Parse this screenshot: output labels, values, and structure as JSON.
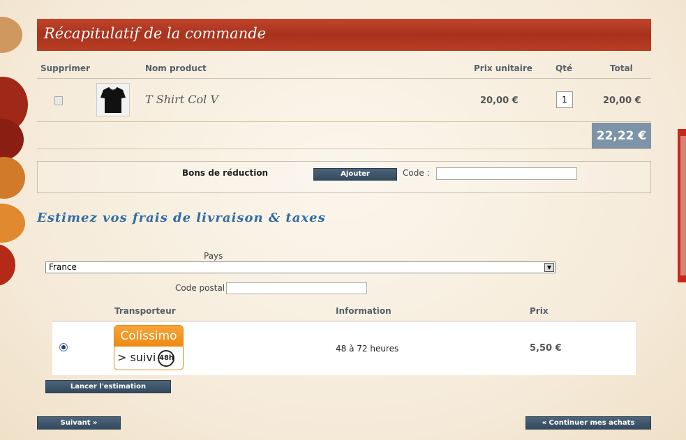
{
  "cart": {
    "title": "Récapitulatif de la commande",
    "headers": {
      "delete": "Supprimer",
      "product": "Nom product",
      "unit_price": "Prix unitaire",
      "qty": "Qté",
      "total": "Total"
    },
    "item": {
      "name": "T Shirt Col V",
      "unit_price": "20,00 €",
      "qty": "1",
      "total": "20,00 €"
    },
    "grand_total": "22,22 €"
  },
  "voucher": {
    "label": "Bons de réduction",
    "add_button": "Ajouter",
    "code_label": "Code :",
    "code_value": ""
  },
  "shipping": {
    "title": "Estimez vos frais de livraison & taxes",
    "country_label": "Pays",
    "country_value": "France",
    "postcode_label": "Code postal",
    "postcode_value": "",
    "headers": {
      "carrier": "Transporteur",
      "info": "Information",
      "price": "Prix"
    },
    "carrier": {
      "logo_top": "Colissimo",
      "logo_bottom": "> suivi",
      "logo_badge": "48h",
      "info": "48 à 72 heures",
      "price": "5,50 €",
      "selected": true
    },
    "estimate_button": "Lancer l'estimation"
  },
  "nav": {
    "next_button": "Suivant »",
    "continue_button": "« Continuer mes achats"
  },
  "colors": {
    "title_bar": "#b23a22",
    "button": "#3a5166",
    "grand_total_bg": "#7c93a8",
    "shipping_title": "#2e6da4"
  },
  "icons": {
    "delete": "trash-icon",
    "select_arrow": "chevron-down-icon"
  }
}
